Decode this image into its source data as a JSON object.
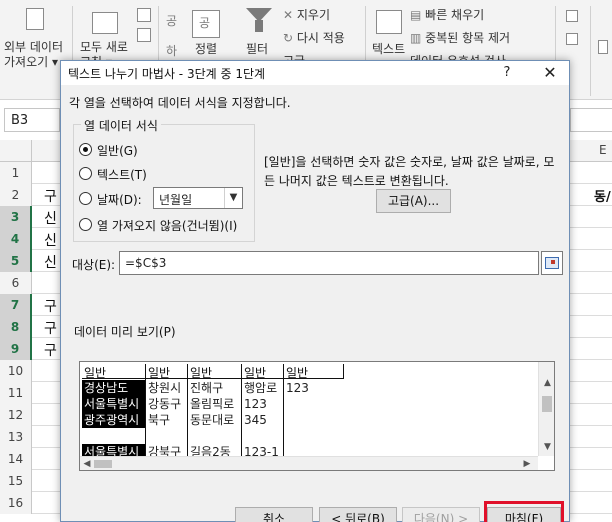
{
  "ribbon": {
    "get_external_data": [
      "외부 데이터",
      "가져오기 ▾"
    ],
    "refresh_all": [
      "모두 새로",
      "고침 ▾"
    ],
    "sort_icon_labels": [
      "공",
      "공",
      "하"
    ],
    "sort": "정렬",
    "filter": "필터",
    "clear": "지우기",
    "reapply": "다시 적용",
    "advanced": "고급",
    "text_to_columns": "텍스트",
    "flash_fill": "빠른 채우기",
    "remove_duplicates": "중복된 항목 제거",
    "data_validation": "데이터 유효성 검사"
  },
  "formula_bar": {
    "name_box": "B3"
  },
  "sheet": {
    "row_numbers": [
      "1",
      "2",
      "3",
      "4",
      "5",
      "6",
      "7",
      "8",
      "9",
      "10",
      "11",
      "12",
      "13",
      "14",
      "15",
      "16"
    ],
    "selected_rows": [
      2,
      3,
      4,
      6,
      7,
      8
    ],
    "visible_cells": {
      "2": "구",
      "3": "신",
      "4": "신",
      "5": "신",
      "7": "구",
      "8": "구",
      "9": "구"
    },
    "right_col_header": "E",
    "right_cell_row2": "동/"
  },
  "dialog": {
    "title": "텍스트 나누기 마법사 - 3단계 중 1단계",
    "help": "?",
    "close": "✕",
    "instruction": "각 열을 선택하여 데이터 서식을 지정합니다.",
    "group_title": "열 데이터 서식",
    "radios": [
      {
        "label": "일반(G)",
        "checked": true
      },
      {
        "label": "텍스트(T)",
        "checked": false
      },
      {
        "label": "날짜(D):",
        "checked": false
      },
      {
        "label": "열 가져오지 않음(건너뜀)(I)",
        "checked": false
      }
    ],
    "date_format": "년월일",
    "description": "[일반]을 선택하면 숫자 값은 숫자로, 날짜 값은 날짜로, 모든 나머지 값은 텍스트로 변환됩니다.",
    "advanced_button": "고급(A)...",
    "destination_label": "대상(E):",
    "destination_value": "=$C$3",
    "preview_label": "데이터 미리 보기(P)",
    "preview": {
      "headers": [
        "일반",
        "일반",
        "일반",
        "일반",
        "일반"
      ],
      "rows": [
        [
          "경상남도",
          "창원시",
          "진해구",
          "행암로",
          "123"
        ],
        [
          "서울특별시",
          "강동구",
          "올림픽로",
          "123",
          ""
        ],
        [
          "광주광역시",
          "북구",
          "동문대로",
          "345",
          ""
        ],
        [
          "",
          "",
          "",
          "",
          ""
        ],
        [
          "서울특별시",
          "강북구",
          "길음2동",
          "123-1",
          ""
        ]
      ]
    },
    "buttons": {
      "cancel": "취소",
      "back": "< 뒤로(B)",
      "next": "다음(N) >",
      "finish": "마침(F)"
    }
  }
}
